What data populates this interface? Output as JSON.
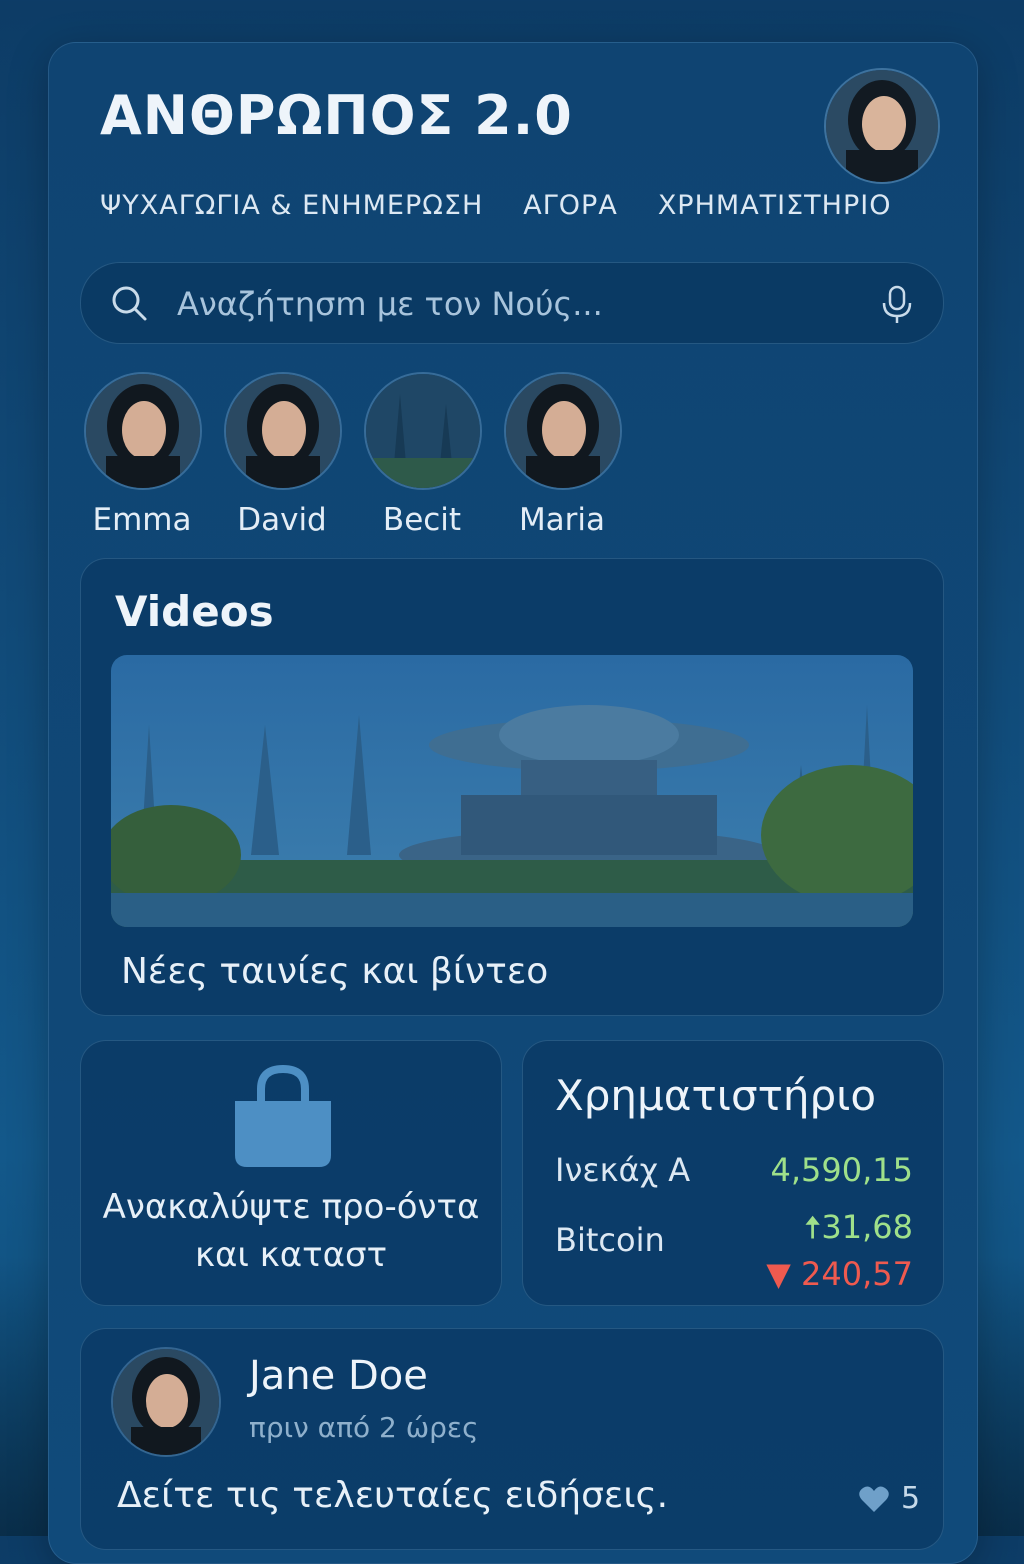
{
  "app": {
    "title": "ΑΝΘΡΩΠΟΣ 2.0"
  },
  "nav": [
    {
      "label": "ΨΥΧΑΓΩΓΙΑ & ΕΝΗΜΕΡΩΣΗ"
    },
    {
      "label": "ΑΓΟΡΑ"
    },
    {
      "label": "ΧΡΗΜΑΤΙΣΤΗΡΙΟ"
    }
  ],
  "search": {
    "placeholder": "Αναζήτησm με τον Νούς..."
  },
  "contacts": [
    {
      "name": "Emma"
    },
    {
      "name": "David"
    },
    {
      "name": "Becit"
    },
    {
      "name": "Maria"
    }
  ],
  "videos": {
    "title": "Videos",
    "caption": "Νέες ταινίες και βίντεο"
  },
  "shop": {
    "text": "Ανακαλύψτε προ-όντα και καταστ"
  },
  "stocks": {
    "title": "Χρηματιστήριο",
    "rows": [
      {
        "name": "Ινεκάχ Α",
        "value": "4,590,15"
      },
      {
        "name": "Bitcoin",
        "value_up": "31,68",
        "value_down": "240,57"
      }
    ],
    "colors": {
      "up": "#9fe08a",
      "down": "#ef5a4f"
    }
  },
  "post": {
    "author": "Jane Doe",
    "time": "πριν από 2 ώρες",
    "message": "Δείτε τις τελευταίες ειδήσεις.",
    "likes": "5"
  }
}
